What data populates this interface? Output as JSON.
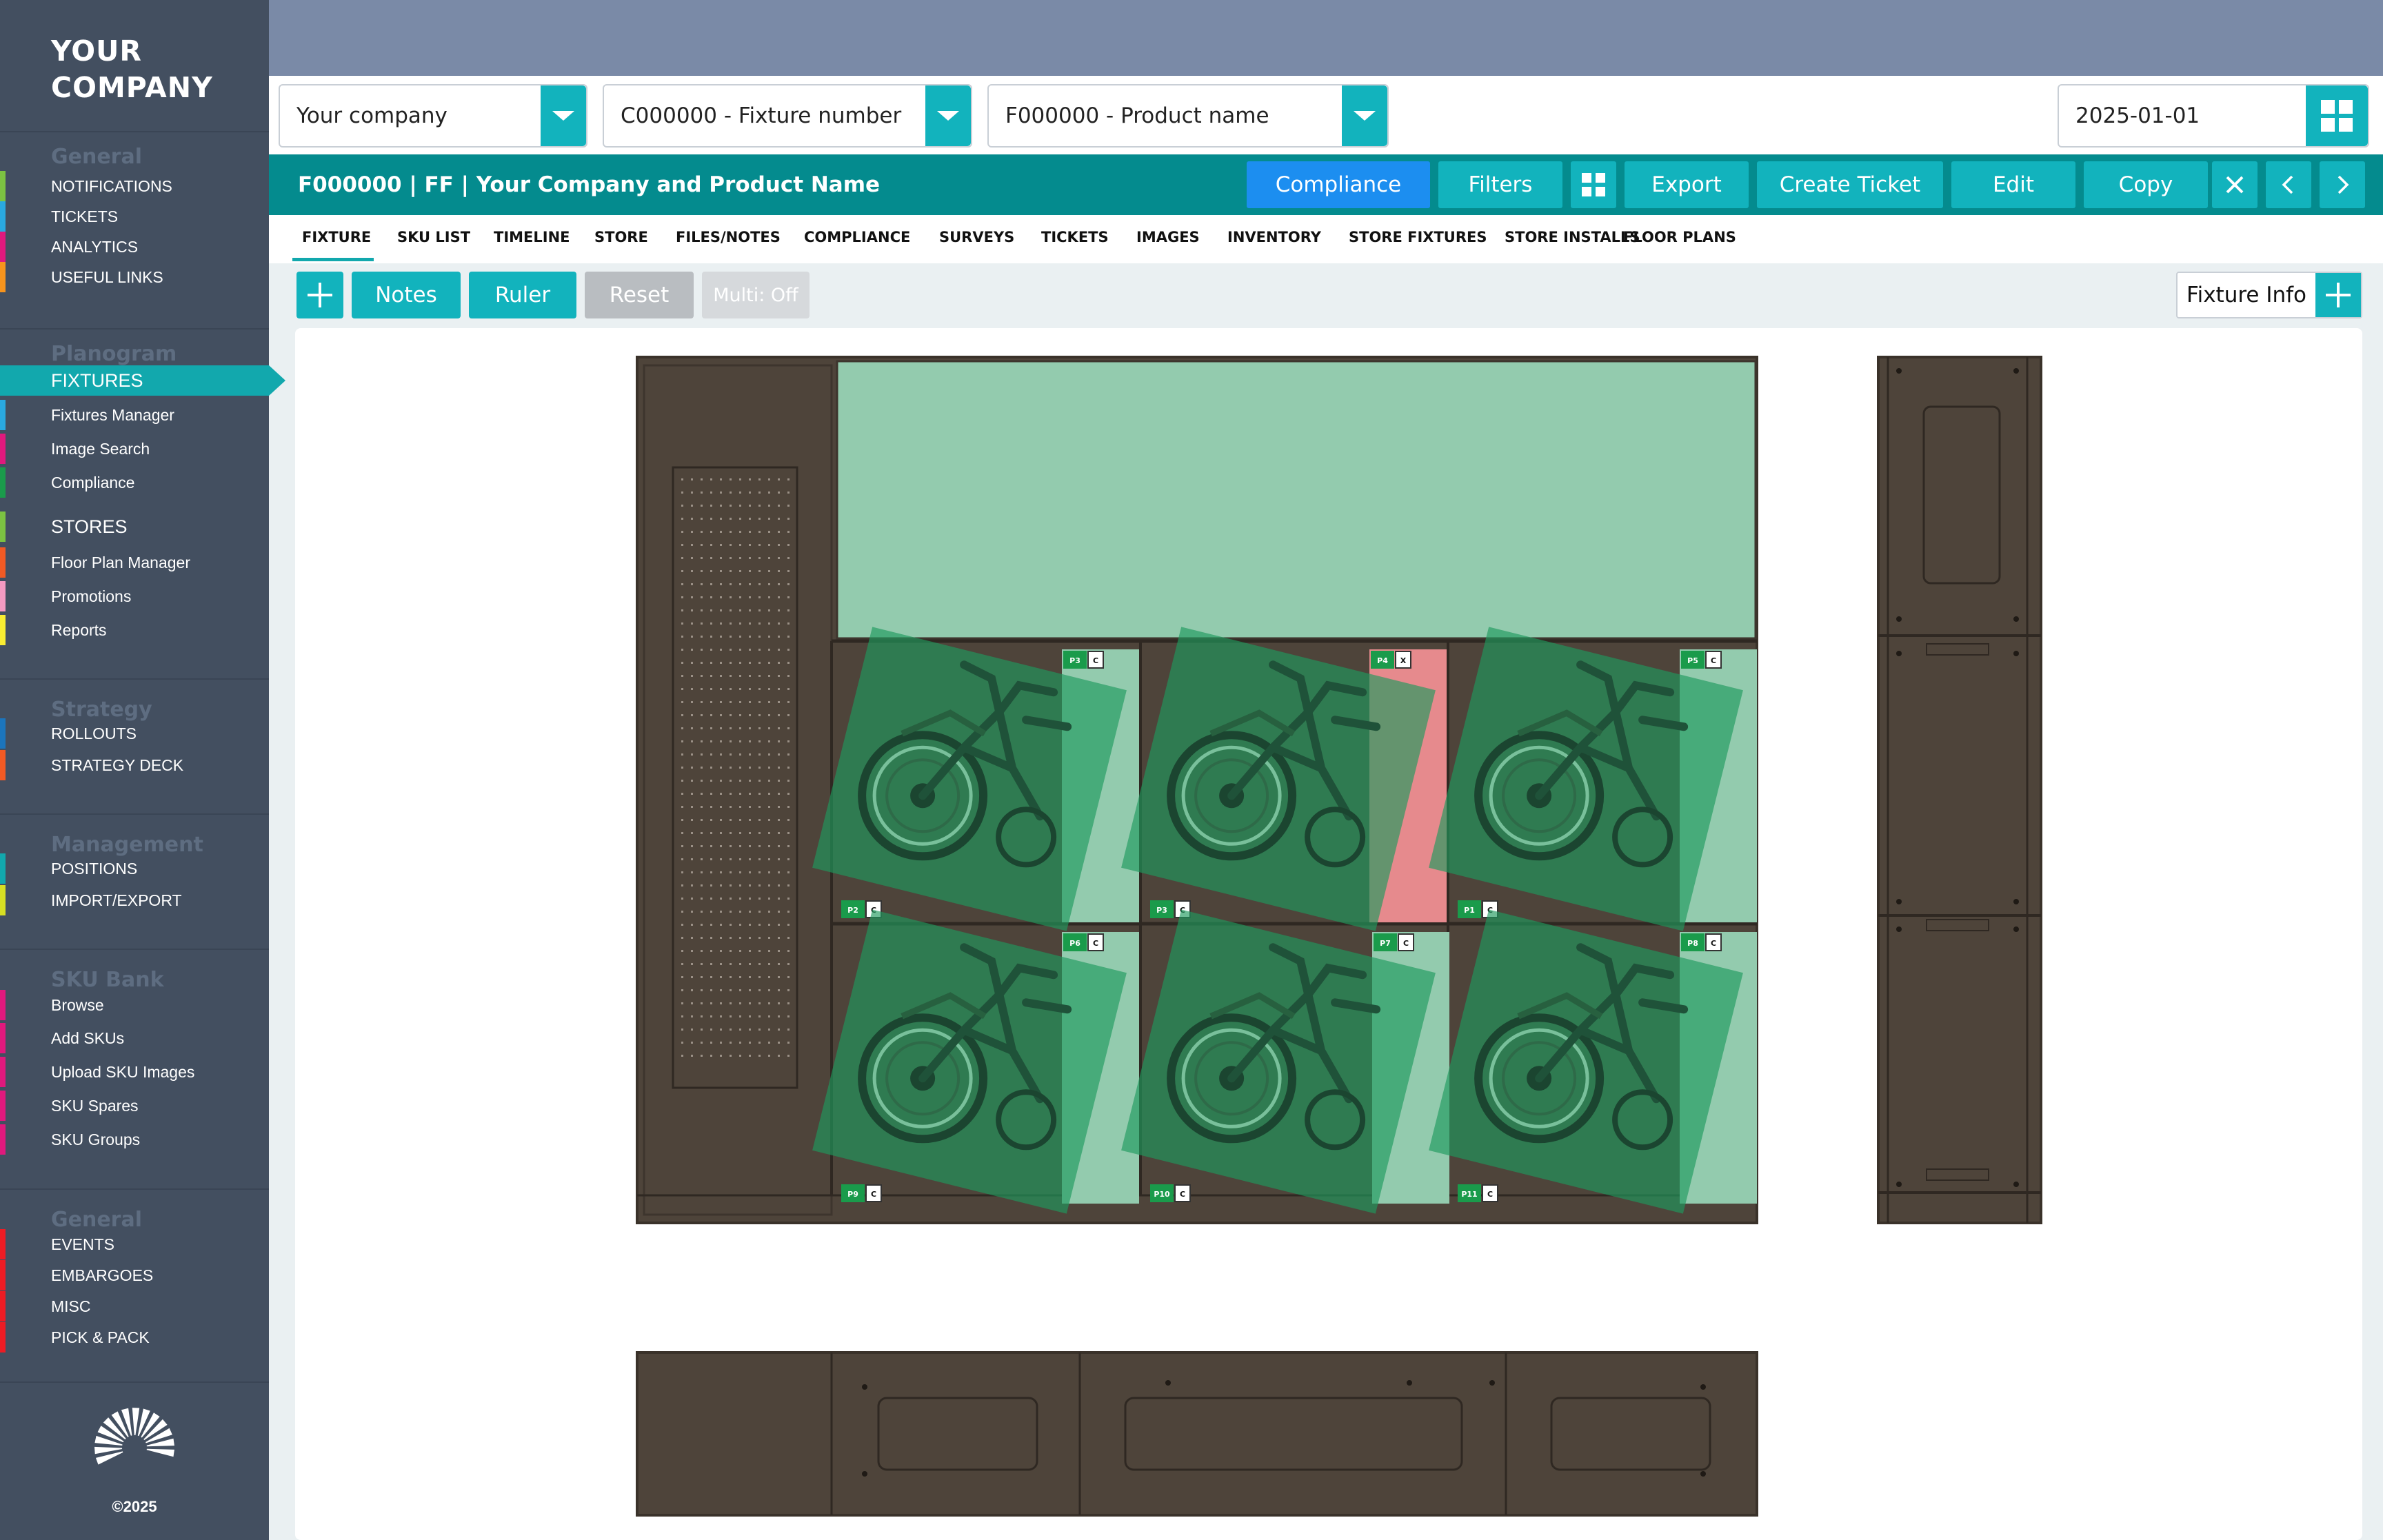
{
  "sidebar": {
    "logo_line1": "YOUR",
    "logo_line2": "COMPANY",
    "sections": [
      {
        "heading": "General",
        "items": [
          {
            "label": "NOTIFICATIONS",
            "color": "#7cc242"
          },
          {
            "label": "TICKETS",
            "color": "#2aa9e0"
          },
          {
            "label": "ANALYTICS",
            "color": "#e0197d"
          },
          {
            "label": "USEFUL LINKS",
            "color": "#f7941d"
          }
        ]
      },
      {
        "heading": "Planogram",
        "items": [
          {
            "label": "FIXTURES",
            "color": "#12a8ad",
            "active": true
          },
          {
            "label": "Fixtures Manager",
            "color": "#2aa9e0"
          },
          {
            "label": "Image Search",
            "color": "#e0197d"
          },
          {
            "label": "Compliance",
            "color": "#1a9b4b"
          },
          {
            "label": "STORES",
            "color": "#7cc242"
          },
          {
            "label": "Floor Plan Manager",
            "color": "#f15a24"
          },
          {
            "label": "Promotions",
            "color": "#f49ac1"
          },
          {
            "label": "Reports",
            "color": "#f9ed32"
          }
        ]
      },
      {
        "heading": "Strategy",
        "items": [
          {
            "label": "ROLLOUTS",
            "color": "#1c75bc"
          },
          {
            "label": "STRATEGY DECK",
            "color": "#f15a24"
          }
        ]
      },
      {
        "heading": "Management",
        "items": [
          {
            "label": "POSITIONS",
            "color": "#12a8ad"
          },
          {
            "label": "IMPORT/EXPORT",
            "color": "#d7df23"
          }
        ]
      },
      {
        "heading": "SKU Bank",
        "items": [
          {
            "label": "Browse",
            "color": "#e0197d"
          },
          {
            "label": "Add SKUs",
            "color": "#e0197d"
          },
          {
            "label": "Upload SKU Images",
            "color": "#e0197d"
          },
          {
            "label": "SKU Spares",
            "color": "#e0197d"
          },
          {
            "label": "SKU Groups",
            "color": "#e0197d"
          }
        ]
      },
      {
        "heading": "General",
        "items": [
          {
            "label": "EVENTS",
            "color": "#ed1c24"
          },
          {
            "label": "EMBARGOES",
            "color": "#ed1c24"
          },
          {
            "label": "MISC",
            "color": "#ed1c24"
          },
          {
            "label": "PICK & PACK",
            "color": "#ed1c24"
          }
        ]
      }
    ],
    "copyright": "©2025"
  },
  "selectors": {
    "company": "Your company",
    "fixture": "C000000 - Fixture number",
    "product": "F000000 - Product name",
    "date": "2025-01-01"
  },
  "titlebar": {
    "title": "F000000 | FF | Your Company and Product Name",
    "buttons": {
      "compliance": "Compliance",
      "filters": "Filters",
      "export": "Export",
      "create_ticket": "Create Ticket",
      "edit": "Edit",
      "copy": "Copy"
    }
  },
  "tabs": [
    "FIXTURE",
    "SKU LIST",
    "TIMELINE",
    "STORE",
    "FILES/NOTES",
    "COMPLIANCE",
    "SURVEYS",
    "TICKETS",
    "IMAGES",
    "INVENTORY",
    "STORE FIXTURES",
    "STORE INSTALLS",
    "FLOOR PLANS"
  ],
  "active_tab": "FIXTURE",
  "toolbar": {
    "notes": "Notes",
    "ruler": "Ruler",
    "reset": "Reset",
    "multi": "Multi: Off",
    "fixture_info": "Fixture Info"
  },
  "colors": {
    "teal": "#12b3bd",
    "dark_teal": "#048b8e",
    "compliance_blue": "#1c8ef0",
    "fixture_brown": "#4e443a",
    "compliant_green": "#93cbae",
    "noncompliant_red": "#e68a8d",
    "product_overlay": "#1f9a5d"
  },
  "positions": [
    {
      "label": "P3",
      "status": "C"
    },
    {
      "label": "P4",
      "status": "X"
    },
    {
      "label": "P5",
      "status": "C"
    },
    {
      "label": "P2",
      "status": "C"
    },
    {
      "label": "P3",
      "status": "C"
    },
    {
      "label": "P1",
      "status": "C"
    },
    {
      "label": "P6",
      "status": "C"
    },
    {
      "label": "P7",
      "status": "C"
    },
    {
      "label": "P8",
      "status": "C"
    },
    {
      "label": "P9",
      "status": "C"
    },
    {
      "label": "P10",
      "status": "C"
    },
    {
      "label": "P11",
      "status": "C"
    }
  ]
}
